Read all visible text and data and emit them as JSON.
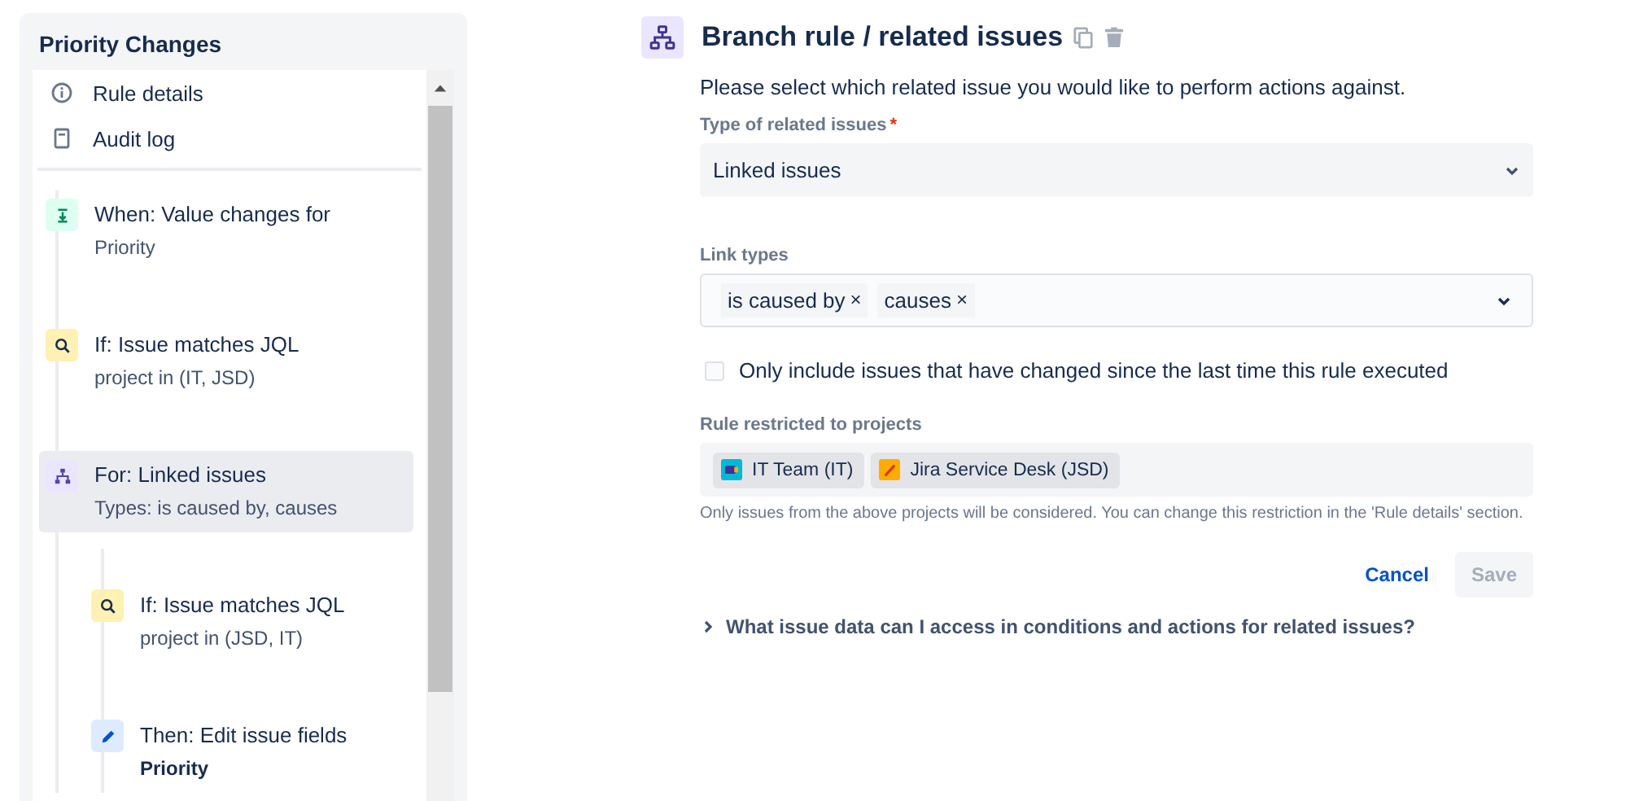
{
  "sidebar": {
    "title": "Priority Changes",
    "links": [
      {
        "kind": "info",
        "label": "Rule details"
      },
      {
        "kind": "log",
        "label": "Audit log"
      }
    ],
    "steps": [
      {
        "kind": "trigger",
        "title": "When: Value changes for",
        "detail": "Priority",
        "selected": false
      },
      {
        "kind": "condition",
        "title": "If: Issue matches JQL",
        "detail": "project in (IT, JSD)",
        "selected": false
      },
      {
        "kind": "branch",
        "title": "For: Linked issues",
        "detail": "Types: is caused by, causes",
        "selected": true,
        "children": [
          {
            "kind": "condition",
            "title": "If: Issue matches JQL",
            "detail": "project in (JSD, IT)",
            "selected": false
          },
          {
            "kind": "action",
            "title": "Then: Edit issue fields",
            "detail": "**Priority**",
            "selected": false
          }
        ]
      }
    ]
  },
  "editor": {
    "title": "Branch rule / related issues",
    "description": "Please select which related issue you would like to perform actions against.",
    "type_field": {
      "label": "Type of related issues",
      "required_mark": "*",
      "value": "Linked issues"
    },
    "link_types": {
      "label": "Link types",
      "tags": [
        {
          "label": "is caused by",
          "remove": "×"
        },
        {
          "label": "causes",
          "remove": "×"
        }
      ]
    },
    "only_changed": {
      "label": "Only include issues that have changed since the last time this rule executed",
      "checked": false
    },
    "projects": {
      "label": "Rule restricted to projects",
      "items": [
        {
          "kind": "it",
          "label": "IT Team (IT)"
        },
        {
          "kind": "jsd",
          "label": "Jira Service Desk (JSD)"
        }
      ],
      "help": "Only issues from the above projects will be considered. You can change this restriction in the 'Rule details' section."
    },
    "buttons": [
      {
        "label": "Cancel",
        "disabled": false,
        "kind": "link"
      },
      {
        "label": "Save",
        "disabled": true,
        "kind": "primary"
      }
    ],
    "faq": {
      "label": "What issue data can I access in conditions and actions for related issues?",
      "expanded": false
    }
  }
}
